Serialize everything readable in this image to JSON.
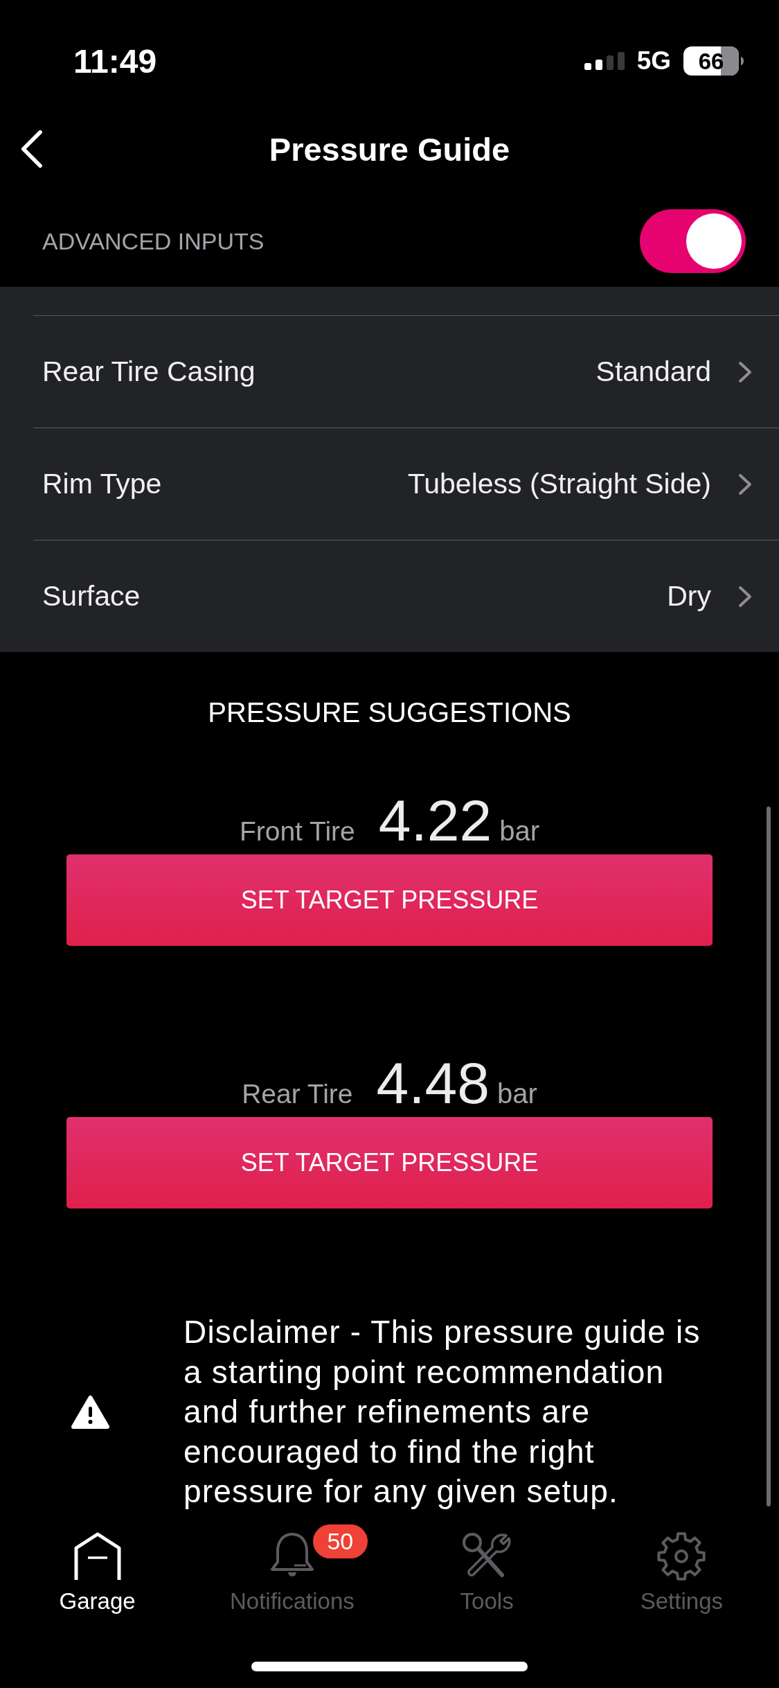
{
  "status_bar": {
    "time": "11:49",
    "network": "5G",
    "battery": "66"
  },
  "header": {
    "title": "Pressure Guide"
  },
  "advanced_inputs": {
    "label": "ADVANCED INPUTS",
    "on": true
  },
  "settings": [
    {
      "label": "Rear Tire Casing",
      "value": "Standard"
    },
    {
      "label": "Rim Type",
      "value": "Tubeless (Straight Side)"
    },
    {
      "label": "Surface",
      "value": "Dry"
    }
  ],
  "pressure_suggestions": {
    "title": "PRESSURE SUGGESTIONS",
    "tires": [
      {
        "label": "Front Tire",
        "value": "4.22",
        "unit": "bar",
        "button": "SET TARGET PRESSURE"
      },
      {
        "label": "Rear Tire",
        "value": "4.48",
        "unit": "bar",
        "button": "SET TARGET PRESSURE"
      }
    ]
  },
  "disclaimer": {
    "text": "Disclaimer - This pressure guide is a starting point recommendation and further refinements are encouraged to find the right pressure for any given setup."
  },
  "tabs": [
    {
      "label": "Garage",
      "selected": true
    },
    {
      "label": "Notifications",
      "selected": false,
      "badge": "50"
    },
    {
      "label": "Tools",
      "selected": false
    },
    {
      "label": "Settings",
      "selected": false
    }
  ]
}
